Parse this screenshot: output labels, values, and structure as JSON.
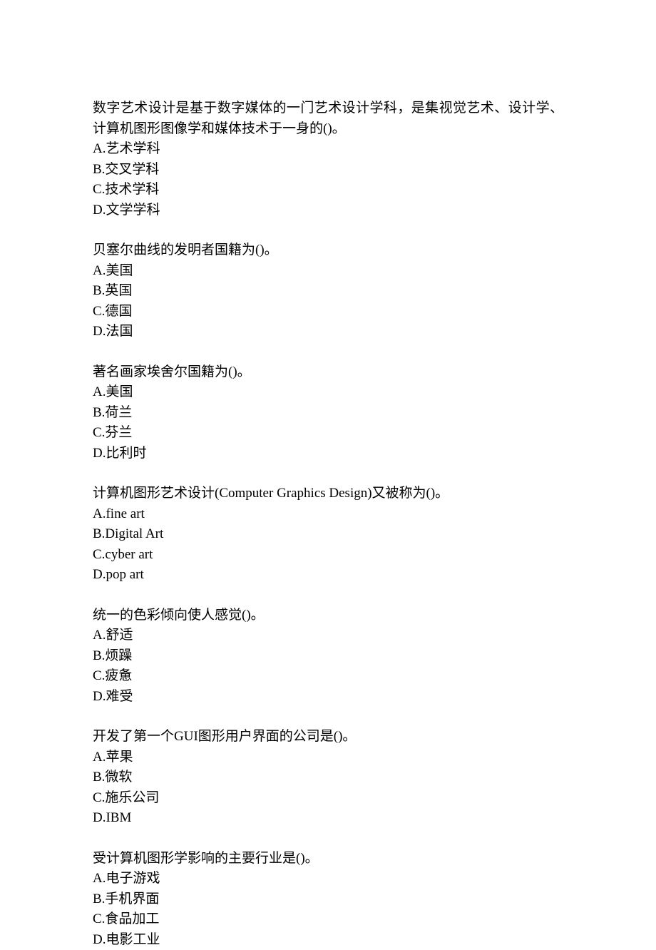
{
  "questions": [
    {
      "stem": "数字艺术设计是基于数字媒体的一门艺术设计学科，是集视觉艺术、设计学、计算机图形图像学和媒体技术于一身的()。",
      "options": [
        "A.艺术学科",
        "B.交叉学科",
        "C.技术学科",
        "D.文学学科"
      ]
    },
    {
      "stem": "贝塞尔曲线的发明者国籍为()。",
      "options": [
        "A.美国",
        "B.英国",
        "C.德国",
        "D.法国"
      ]
    },
    {
      "stem": "著名画家埃舍尔国籍为()。",
      "options": [
        "A.美国",
        "B.荷兰",
        "C.芬兰",
        "D.比利时"
      ]
    },
    {
      "stem": "计算机图形艺术设计(Computer Graphics Design)又被称为()。",
      "options": [
        "A.fine art",
        "B.Digital Art",
        "C.cyber art",
        "D.pop art"
      ]
    },
    {
      "stem": "统一的色彩倾向使人感觉()。",
      "options": [
        "A.舒适",
        "B.烦躁",
        "C.疲惫",
        "D.难受"
      ]
    },
    {
      "stem": "开发了第一个GUI图形用户界面的公司是()。",
      "options": [
        "A.苹果",
        "B.微软",
        "C.施乐公司",
        "D.IBM"
      ]
    },
    {
      "stem": "受计算机图形学影响的主要行业是()。",
      "options": [
        "A.电子游戏",
        "B.手机界面",
        "C.食品加工",
        "D.电影工业"
      ]
    }
  ]
}
